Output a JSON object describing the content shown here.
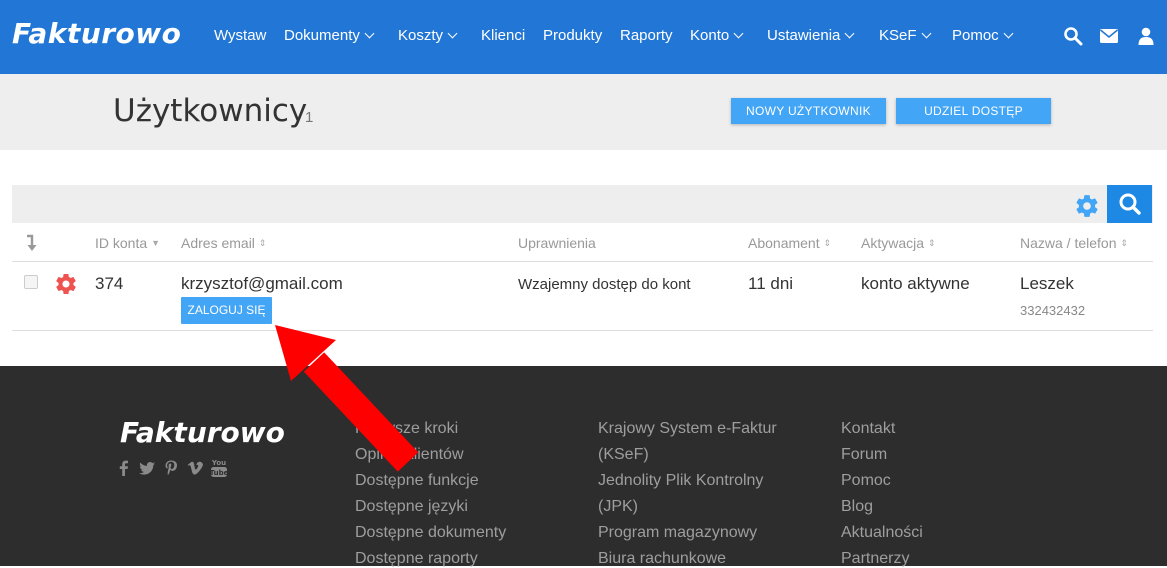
{
  "brand": "Fakturowo",
  "nav": {
    "items": [
      {
        "label": "Wystaw",
        "dropdown": false
      },
      {
        "label": "Dokumenty",
        "dropdown": true
      },
      {
        "label": "Koszty",
        "dropdown": true
      },
      {
        "label": "Klienci",
        "dropdown": false
      },
      {
        "label": "Produkty",
        "dropdown": false
      },
      {
        "label": "Raporty",
        "dropdown": false
      },
      {
        "label": "Konto",
        "dropdown": true
      },
      {
        "label": "Ustawienia",
        "dropdown": true
      },
      {
        "label": "KSeF",
        "dropdown": true
      },
      {
        "label": "Pomoc",
        "dropdown": true
      }
    ],
    "icons": [
      "search-icon",
      "envelope-icon",
      "user-icon"
    ]
  },
  "header": {
    "title": "Użytkownicy",
    "count": "1",
    "new_user_button": "NOWY UŻYTKOWNIK",
    "grant_access_button": "UDZIEL DOSTĘP"
  },
  "table": {
    "columns": {
      "id": "ID konta",
      "email": "Adres email",
      "permissions": "Uprawnienia",
      "subscription": "Abonament",
      "activation": "Aktywacja",
      "name_phone": "Nazwa / telefon"
    },
    "rows": [
      {
        "id": "374",
        "email": "krzysztof@gmail.com",
        "login_button": "ZALOGUJ SIĘ",
        "permissions": "Wzajemny dostęp do kont",
        "subscription": "11 dni",
        "activation": "konto aktywne",
        "name": "Leszek",
        "phone": "332432432"
      }
    ]
  },
  "footer": {
    "logo": "Fakturowo",
    "social": [
      "facebook-icon",
      "twitter-icon",
      "pinterest-icon",
      "vimeo-icon",
      "youtube-icon"
    ],
    "col1": [
      "Pierwsze kroki",
      "Opinie klientów",
      "Dostępne funkcje",
      "Dostępne języki",
      "Dostępne dokumenty",
      "Dostępne raporty"
    ],
    "col2": [
      "Krajowy System e-Faktur",
      "(KSeF)",
      "Jednolity Plik Kontrolny",
      "(JPK)",
      "Program magazynowy",
      "Biura rachunkowe"
    ],
    "col3": [
      "Kontakt",
      "Forum",
      "Pomoc",
      "Blog",
      "Aktualności",
      "Partnerzy"
    ]
  },
  "colors": {
    "nav_bg": "#2277d6",
    "button_blue": "#42a5f5",
    "footer_bg": "#2d2d2d",
    "gear_red": "#ef5350",
    "annotation_arrow": "#ff0000"
  }
}
